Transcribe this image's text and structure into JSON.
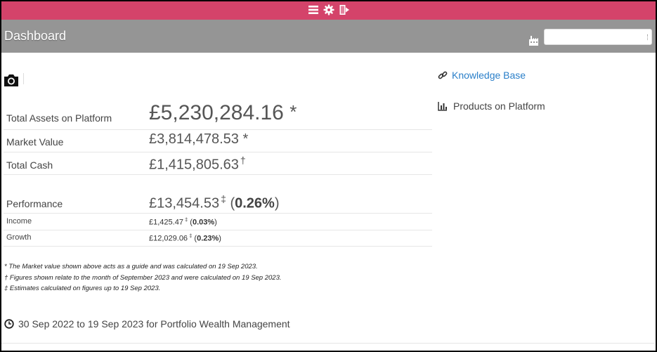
{
  "topbar": {
    "icons": [
      "menu-icon",
      "gear-icon",
      "logout-icon"
    ],
    "color": "#d4436a"
  },
  "header": {
    "title": "Dashboard",
    "search_value": "",
    "color": "#959595"
  },
  "summary": {
    "total_assets": {
      "label": "Total Assets on Platform",
      "value": "£5,230,284.16",
      "mark": "*"
    },
    "market_value": {
      "label": "Market Value",
      "value": "£3,814,478.53",
      "mark": "*"
    },
    "total_cash": {
      "label": "Total Cash",
      "value": "£1,415,805.63",
      "mark": "†"
    },
    "performance": {
      "label": "Performance",
      "value": "£13,454.53",
      "mark": "‡",
      "pct": "0.26%"
    },
    "income": {
      "label": "Income",
      "value": "£1,425.47",
      "mark": "‡",
      "pct": "0.03%"
    },
    "growth": {
      "label": "Growth",
      "value": "£12,029.06",
      "mark": "‡",
      "pct": "0.23%"
    }
  },
  "notes": [
    "* The Market value shown above acts as a guide and was calculated on 19 Sep 2023.",
    "† Figures shown relate to the month of September 2023 and were calculated on 19 Sep 2023.",
    "‡ Estimates calculated on figures up to 19 Sep 2023."
  ],
  "period": "30 Sep 2022 to 19 Sep 2023 for Portfolio Wealth Management",
  "sidebar": {
    "knowledge_base": "Knowledge Base",
    "products": "Products on Platform",
    "link_color": "#2a7fc9"
  }
}
